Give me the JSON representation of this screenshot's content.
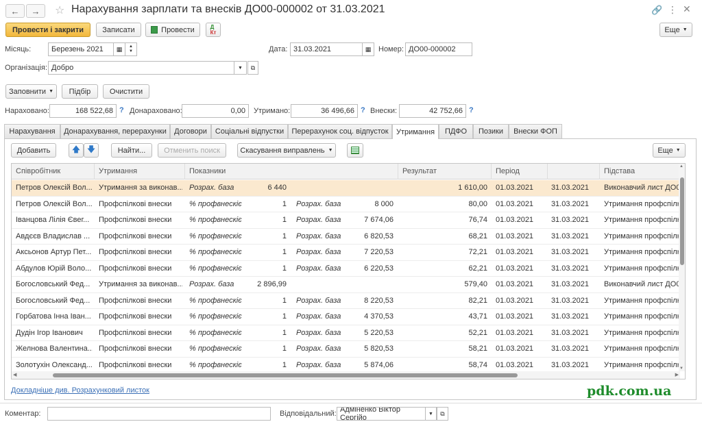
{
  "window": {
    "title": "Нарахування зарплати та внесків ДО00-000002 от 31.03.2021"
  },
  "toolbar": {
    "post_close": "Провести і закрити",
    "save": "Записати",
    "post": "Провести",
    "more": "Еще"
  },
  "header": {
    "month_label": "Місяць:",
    "month_value": "Березень 2021",
    "date_label": "Дата:",
    "date_value": "31.03.2021",
    "number_label": "Номер:",
    "number_value": "ДО00-000002",
    "org_label": "Організація:",
    "org_value": "Добро"
  },
  "actions": {
    "fill": "Заповнити",
    "select": "Підбір",
    "clear": "Очистити"
  },
  "totals": {
    "accrued_label": "Нараховано:",
    "accrued_value": "168 522,68",
    "extra_label": "Донараховано:",
    "extra_value": "0,00",
    "withheld_label": "Утримано:",
    "withheld_value": "36 496,66",
    "contrib_label": "Внески:",
    "contrib_value": "42 752,66",
    "q": "?"
  },
  "tabs": [
    {
      "label": "Нарахування"
    },
    {
      "label": "Донарахування, перерахунки"
    },
    {
      "label": "Договори"
    },
    {
      "label": "Соціальні відпустки"
    },
    {
      "label": "Перерахунок соц. відпусток"
    },
    {
      "label": "Утримання"
    },
    {
      "label": "ПДФО"
    },
    {
      "label": "Позики"
    },
    {
      "label": "Внески ФОП"
    }
  ],
  "grid_toolbar": {
    "add": "Добавить",
    "find": "Найти...",
    "cancel_search": "Отменить поиск",
    "cancel_fix": "Скасування виправлень",
    "more": "Еще"
  },
  "grid": {
    "columns": [
      "Співробітник",
      "Утримання",
      "Показники",
      "Результат",
      "Період",
      "Підстава"
    ],
    "rows": [
      {
        "emp": "Петров Олексій Вол...",
        "ded": "Утримання за виконав...",
        "p1": "Розрах. база",
        "v1": "6 440",
        "p2": "",
        "v2": "",
        "res": "1 610,00",
        "from": "01.03.2021",
        "to": "31.03.2021",
        "basis": "Виконавчий лист ДО00"
      },
      {
        "emp": "Петров Олексій Вол...",
        "ded": "Профспілкові внески",
        "p1": "% профвнескіє",
        "v1": "1",
        "p2": "Розрах. база",
        "v2": "8 000",
        "res": "80,00",
        "from": "01.03.2021",
        "to": "31.03.2021",
        "basis": "Утримання профспілкс"
      },
      {
        "emp": "Іванцова Лілія Євег...",
        "ded": "Профспілкові внески",
        "p1": "% профвнескіє",
        "v1": "1",
        "p2": "Розрах. база",
        "v2": "7 674,06",
        "res": "76,74",
        "from": "01.03.2021",
        "to": "31.03.2021",
        "basis": "Утримання профспілкс"
      },
      {
        "emp": "Авдєєв Владислав ...",
        "ded": "Профспілкові внески",
        "p1": "% профвнескіє",
        "v1": "1",
        "p2": "Розрах. база",
        "v2": "6 820,53",
        "res": "68,21",
        "from": "01.03.2021",
        "to": "31.03.2021",
        "basis": "Утримання профспілкс"
      },
      {
        "emp": "Аксьонов Артур Пет...",
        "ded": "Профспілкові внески",
        "p1": "% профвнескіє",
        "v1": "1",
        "p2": "Розрах. база",
        "v2": "7 220,53",
        "res": "72,21",
        "from": "01.03.2021",
        "to": "31.03.2021",
        "basis": "Утримання профспілкс"
      },
      {
        "emp": "Абдулов Юрій Воло...",
        "ded": "Профспілкові внески",
        "p1": "% профвнескіє",
        "v1": "1",
        "p2": "Розрах. база",
        "v2": "6 220,53",
        "res": "62,21",
        "from": "01.03.2021",
        "to": "31.03.2021",
        "basis": "Утримання профспілкс"
      },
      {
        "emp": "Богословський Фед...",
        "ded": "Утримання за виконав...",
        "p1": "Розрах. база",
        "v1": "2 896,99",
        "p2": "",
        "v2": "",
        "res": "579,40",
        "from": "01.03.2021",
        "to": "31.03.2021",
        "basis": "Виконавчий лист ДО00"
      },
      {
        "emp": "Богословський Фед...",
        "ded": "Профспілкові внески",
        "p1": "% профвнескіє",
        "v1": "1",
        "p2": "Розрах. база",
        "v2": "8 220,53",
        "res": "82,21",
        "from": "01.03.2021",
        "to": "31.03.2021",
        "basis": "Утримання профспілкс"
      },
      {
        "emp": "Горбатова Інна Іван...",
        "ded": "Профспілкові внески",
        "p1": "% профвнескіє",
        "v1": "1",
        "p2": "Розрах. база",
        "v2": "4 370,53",
        "res": "43,71",
        "from": "01.03.2021",
        "to": "31.03.2021",
        "basis": "Утримання профспілкс"
      },
      {
        "emp": "Дудін Ігор Іванович",
        "ded": "Профспілкові внески",
        "p1": "% профвнескіє",
        "v1": "1",
        "p2": "Розрах. база",
        "v2": "5 220,53",
        "res": "52,21",
        "from": "01.03.2021",
        "to": "31.03.2021",
        "basis": "Утримання профспілкс"
      },
      {
        "emp": "Желнова Валентина...",
        "ded": "Профспілкові внески",
        "p1": "% профвнескіє",
        "v1": "1",
        "p2": "Розрах. база",
        "v2": "5 820,53",
        "res": "58,21",
        "from": "01.03.2021",
        "to": "31.03.2021",
        "basis": "Утримання профспілкс"
      },
      {
        "emp": "Золотухін Олександ...",
        "ded": "Профспілкові внески",
        "p1": "% профвнескіє",
        "v1": "1",
        "p2": "Розрах. база",
        "v2": "5 874,06",
        "res": "58,74",
        "from": "01.03.2021",
        "to": "31.03.2021",
        "basis": "Утримання профспілкс"
      }
    ]
  },
  "footer": {
    "link": "Докладніше див. Розрахунковий листок",
    "watermark": "pdk.com.ua",
    "comment_label": "Коментар:",
    "comment_value": "",
    "responsible_label": "Відповідальний:",
    "responsible_value": "Адміненко Віктор Сергійо"
  }
}
